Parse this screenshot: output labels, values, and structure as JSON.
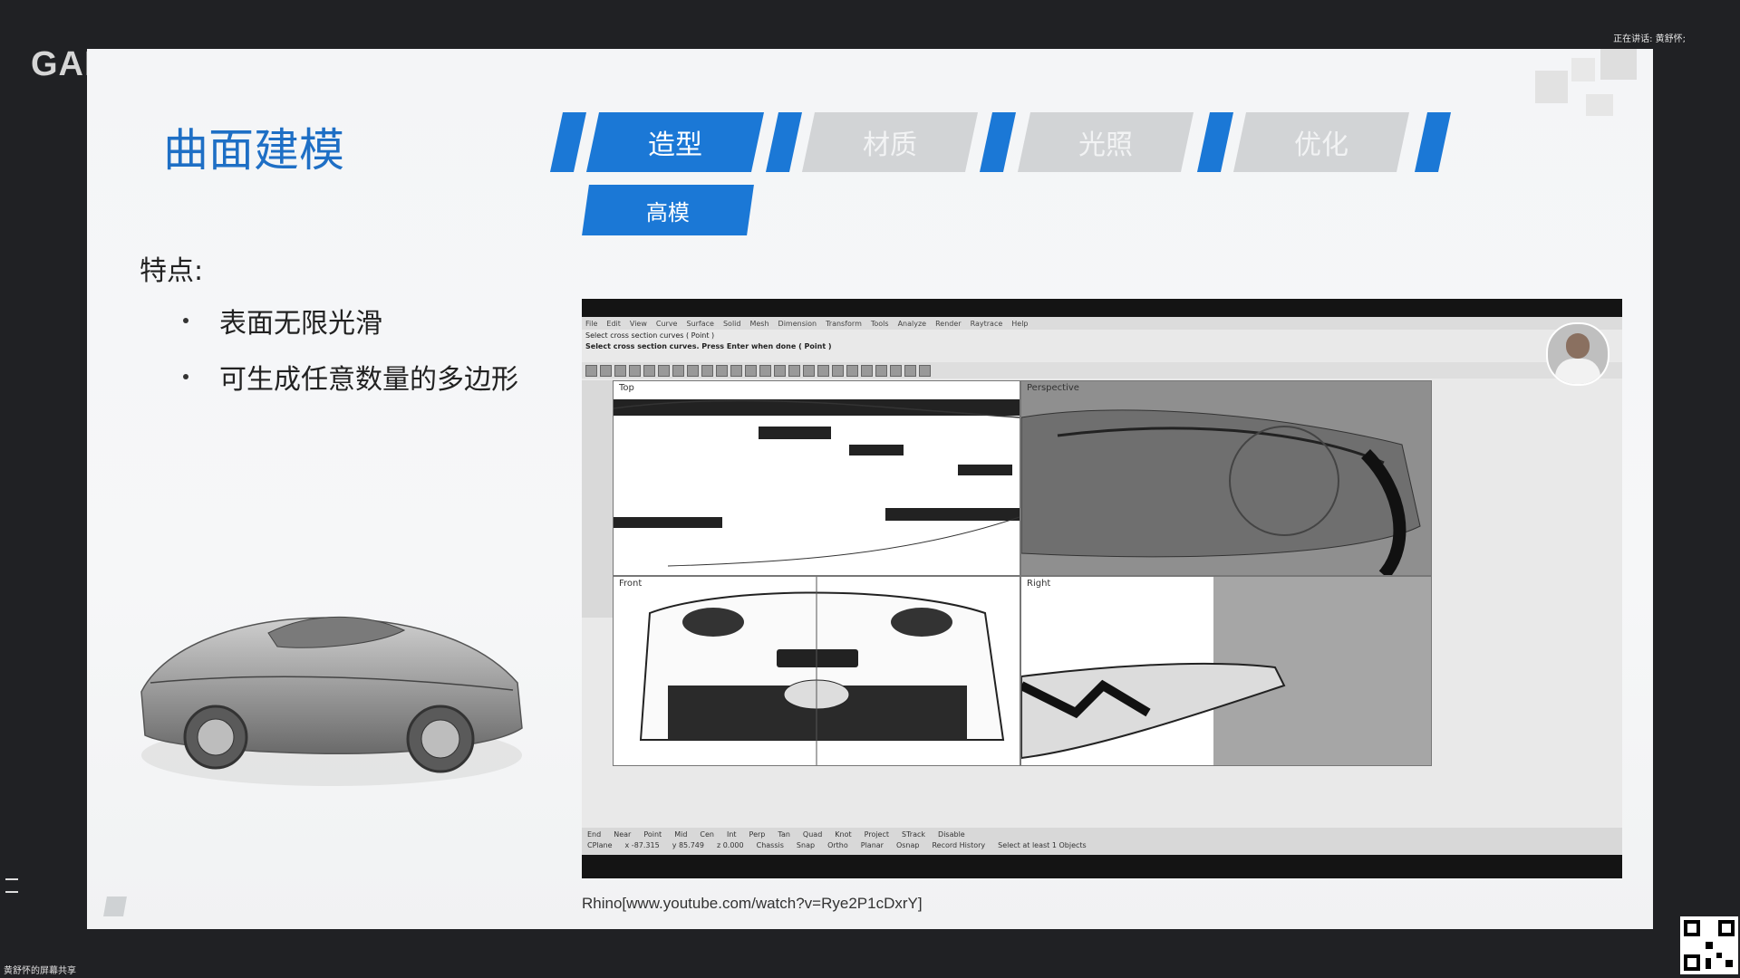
{
  "background": {
    "logo_text": "GAM",
    "status_right": "正在讲话: 黄舒怀;",
    "bottom_left": "黄舒怀的屏幕共享"
  },
  "slide": {
    "title": "曲面建模",
    "tabs": [
      {
        "label": "造型",
        "active": true
      },
      {
        "label": "材质",
        "active": false
      },
      {
        "label": "光照",
        "active": false
      },
      {
        "label": "优化",
        "active": false
      }
    ],
    "subtab": "高模",
    "features_heading": "特点:",
    "features": [
      "表面无限光滑",
      "可生成任意数量的多边形"
    ],
    "caption": "Rhino[www.youtube.com/watch?v=Rye2P1cDxrY]",
    "accent_color": "#1b78d6",
    "title_color": "#1e6fc5"
  },
  "rhino": {
    "menu": [
      "File",
      "Edit",
      "View",
      "Curve",
      "Surface",
      "Solid",
      "Mesh",
      "Dimension",
      "Transform",
      "Tools",
      "Analyze",
      "Render",
      "Raytrace",
      "Help"
    ],
    "command_1": "Select cross section curves ( Point )",
    "command_2": "Select cross section curves. Press Enter when done ( Point )",
    "viewports": {
      "top": "Top",
      "perspective": "Perspective",
      "front": "Front",
      "right": "Right"
    },
    "osnaps": [
      "End",
      "Near",
      "Point",
      "Mid",
      "Cen",
      "Int",
      "Perp",
      "Tan",
      "Quad",
      "Knot",
      "Project",
      "STrack",
      "Disable"
    ],
    "status": [
      "CPlane",
      "x -87.315",
      "y 85.749",
      "z 0.000",
      "Chassis",
      "Snap",
      "Ortho",
      "Planar",
      "Osnap",
      "Record History",
      "Select at least 1 Objects"
    ]
  }
}
